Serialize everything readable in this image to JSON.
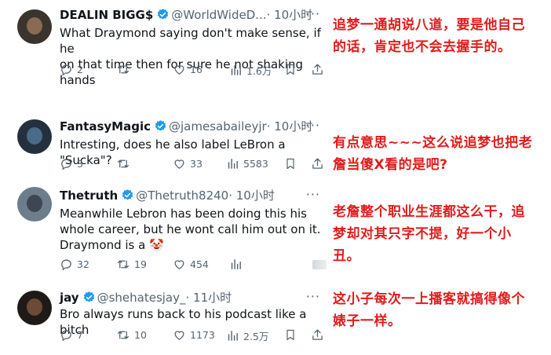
{
  "tweets": [
    {
      "name": "DEALIN BIGG$",
      "handle": "@WorldWideD...",
      "time": "· 10小时",
      "text": "What Draymond saying don't make sense, if he\non that time then for sure he not shaking hands",
      "replies": "2",
      "retweets": "",
      "likes": "16",
      "views": "1.6万"
    },
    {
      "name": "FantasyMagic",
      "handle": "@jamesabaileyjr",
      "time": "· 10小时",
      "text": "Intresting, does he also label LeBron a \"Sucka\"?",
      "replies": "3",
      "retweets": "",
      "likes": "33",
      "views": "5583"
    },
    {
      "name": "Thetruth",
      "handle": "@Thetruth8240",
      "time": "· 10小时",
      "text": "Meanwhile Lebron has been doing this his\nwhole career, but he wont call him out on it.\nDraymond is a 🤡",
      "replies": "32",
      "retweets": "19",
      "likes": "454",
      "views": ""
    },
    {
      "name": "jay",
      "handle": "@shehatesjay_",
      "time": "· 11小时",
      "text": "Bro always runs back to his podcast like a bitch",
      "replies": "7",
      "retweets": "10",
      "likes": "1173",
      "views": "2.5万"
    }
  ],
  "notes": [
    "追梦一通胡说八道，要是他自己\n的话，肯定也不会去握手的。",
    "有点意思~~~这么说追梦也把老\n詹当傻X看的是吧?",
    "老詹整个职业生涯都这么干，追\n梦却对其只字不提，好一个小\n丑。",
    "这小子每次一上播客就搞得像个\n婊子一样。"
  ],
  "colors": {
    "verified": "#1d9bf0",
    "note_text": "#e11b1b",
    "secondary_text": "#536471"
  },
  "icons": [
    "reply-icon",
    "retweet-icon",
    "like-icon",
    "views-icon",
    "bookmark-icon",
    "share-icon",
    "verified-badge-icon",
    "more-icon"
  ]
}
